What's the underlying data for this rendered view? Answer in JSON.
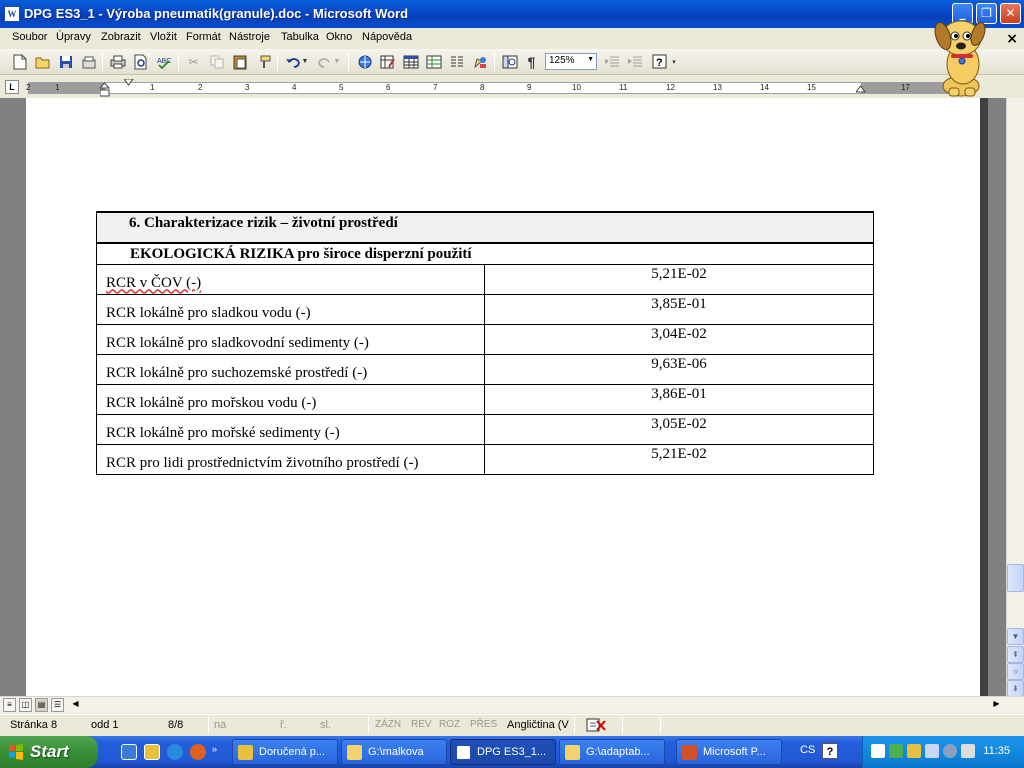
{
  "window": {
    "title": "DPG ES3_1 - Výroba pneumatik(granule).doc - Microsoft Word",
    "app_icon_letter": "W"
  },
  "menu": {
    "items": [
      "Soubor",
      "Úpravy",
      "Zobrazit",
      "Vložit",
      "Formát",
      "Nástroje",
      "Tabulka",
      "Okno",
      "Nápověda"
    ],
    "close_doc": "×"
  },
  "toolbar": {
    "zoom": "125%",
    "buttons": [
      "new-icon",
      "open-icon",
      "save-icon",
      "permission-icon",
      "print-icon",
      "print-preview-icon",
      "spelling-icon",
      "cut-icon",
      "copy-icon",
      "paste-icon",
      "format-painter-icon",
      "undo-icon",
      "redo-icon",
      "hyperlink-icon",
      "tables-borders-icon",
      "insert-table-icon",
      "insert-excel-icon",
      "columns-icon",
      "drawing-icon",
      "document-map-icon",
      "show-formatting-icon",
      "zoom-dropdown",
      "decrease-indent-icon",
      "increase-indent-icon",
      "help-icon"
    ],
    "pilcrow": "¶"
  },
  "ruler": {
    "tab_selector": "L",
    "numbers": [
      "1",
      "2",
      "1",
      "2",
      "3",
      "4",
      "5",
      "6",
      "7",
      "8",
      "9",
      "10",
      "11",
      "12",
      "13",
      "14",
      "15",
      "17"
    ]
  },
  "document": {
    "section_heading": "6. Charakterizace rizik – životní prostředí",
    "subheading": "EKOLOGICKÁ RIZIKA pro široce disperzní použití",
    "rows": [
      {
        "label": "RCR v ČOV (-)",
        "value": "5,21E-02"
      },
      {
        "label": "RCR lokálně pro sladkou vodu (-)",
        "value": "3,85E-01"
      },
      {
        "label": "RCR lokálně pro sladkovodní sedimenty (-)",
        "value": "3,04E-02"
      },
      {
        "label": "RCR lokálně pro suchozemské prostředí (-)",
        "value": "9,63E-06"
      },
      {
        "label": "RCR lokálně pro mořskou vodu (-)",
        "value": "3,86E-01"
      },
      {
        "label": "RCR lokálně pro mořské sedimenty (-)",
        "value": "3,05E-02"
      },
      {
        "label": "RCR pro lidi prostřednictvím životního prostředí (-)",
        "value": "5,21E-02"
      }
    ]
  },
  "statusbar": {
    "page": "Stránka  8",
    "section": "odd  1",
    "pages": "8/8",
    "at": "na",
    "line": "ř.",
    "col": "sl.",
    "rec": "ZÁZN",
    "trk": "REV",
    "ext": "ROZ",
    "ovr": "PŘES",
    "language": "Angličtina (V"
  },
  "taskbar": {
    "start": "Start",
    "tasks": [
      {
        "label": "Doručená p...",
        "icon": "outlook-icon",
        "active": false
      },
      {
        "label": "G:\\malkova",
        "icon": "folder-icon",
        "active": false
      },
      {
        "label": "DPG ES3_1...",
        "icon": "word-icon",
        "active": true
      },
      {
        "label": "G:\\adaptab...",
        "icon": "folder-icon",
        "active": false
      },
      {
        "label": "Microsoft P...",
        "icon": "powerpoint-icon",
        "active": false
      }
    ],
    "language": "CS",
    "help": "?",
    "clock": "11:35"
  },
  "colors": {
    "titlebar": "#0a5fd8",
    "taskbar": "#245edb",
    "start": "#3a8f38",
    "tray": "#138ae0"
  }
}
